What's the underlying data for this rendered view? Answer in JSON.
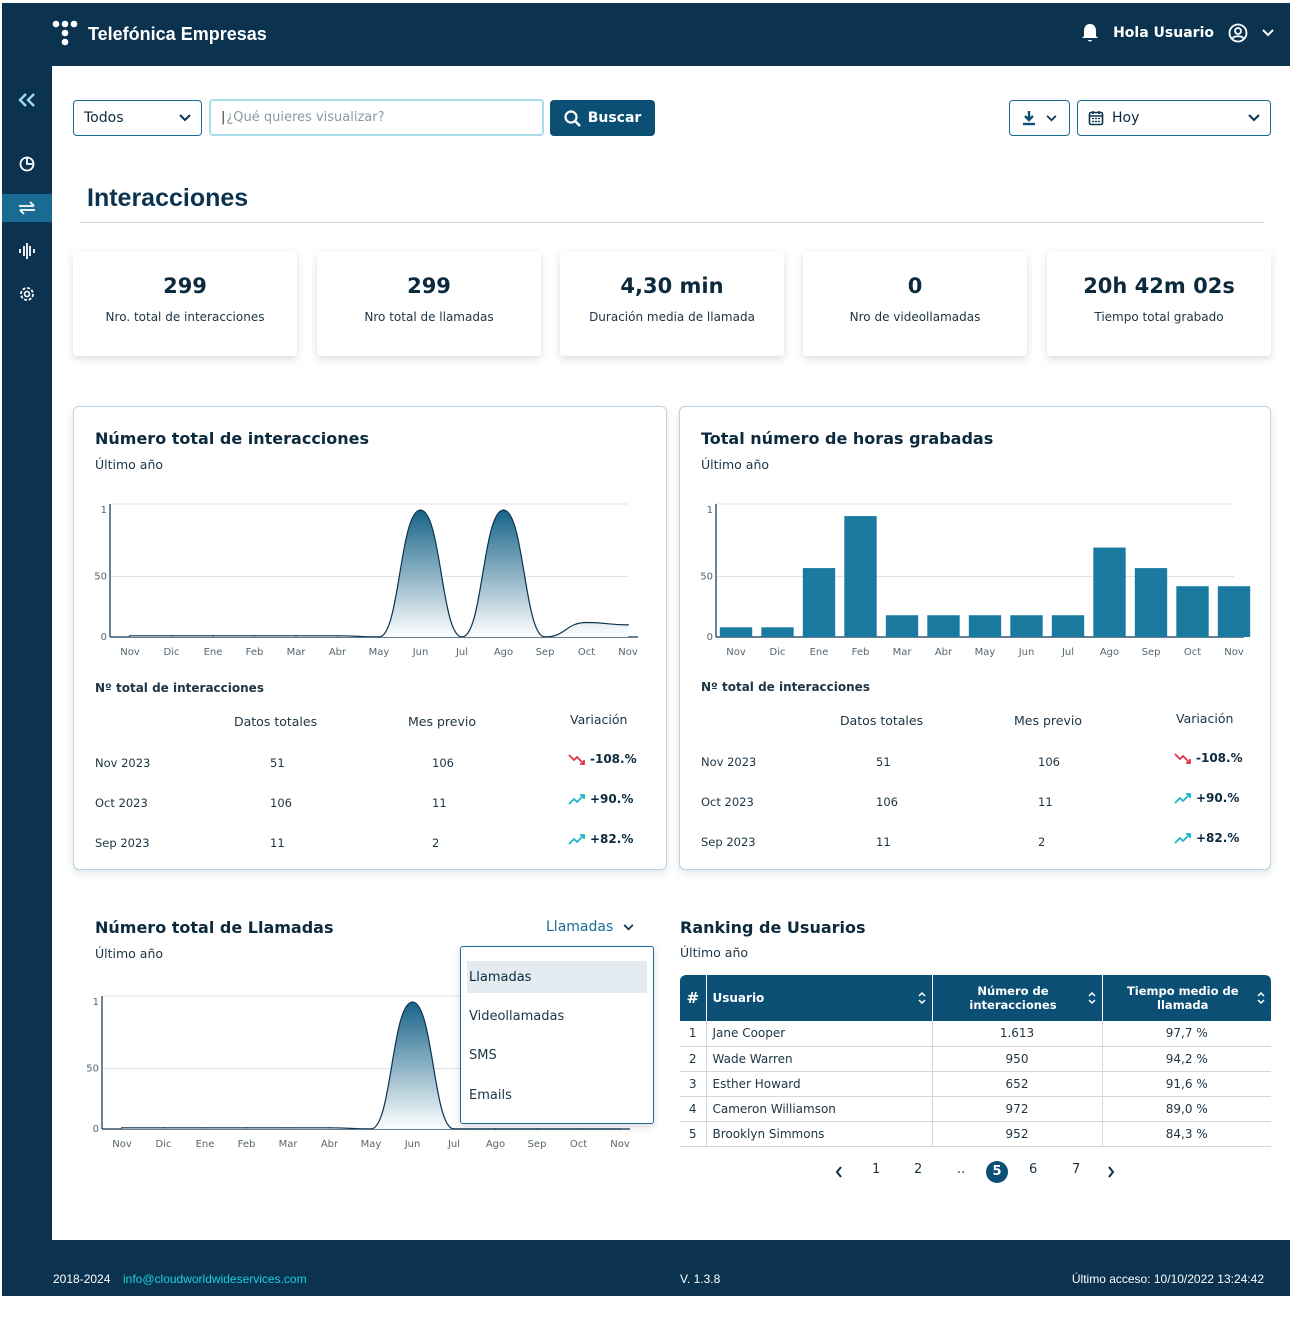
{
  "app": {
    "brand": "Telefónica Empresas",
    "greeting": "Hola Usuario"
  },
  "toolbar": {
    "filter_value": "Todos",
    "search_placeholder": "¿Qué quieres visualizar?",
    "search_button": "Buscar",
    "date_value": "Hoy"
  },
  "page": {
    "title": "Interacciones"
  },
  "kpis": [
    {
      "value": "299",
      "label": "Nro. total de interacciones"
    },
    {
      "value": "299",
      "label": "Nro total de llamadas"
    },
    {
      "value": "4,30 min",
      "label": "Duración media de llamada"
    },
    {
      "value": "0",
      "label": "Nro de videollamadas"
    },
    {
      "value": "20h 42m 02s",
      "label": "Tiempo total grabado"
    }
  ],
  "card1": {
    "title": "Número total de interacciones",
    "subtitle": "Último año",
    "table_title": "Nº total de interacciones",
    "headers": [
      "Datos totales",
      "Mes previo",
      "Variación"
    ],
    "rows": [
      {
        "period": "Nov 2023",
        "total": "51",
        "prev": "106",
        "var": "-108.%",
        "trend": "down"
      },
      {
        "period": "Oct 2023",
        "total": "106",
        "prev": "11",
        "var": "+90.%",
        "trend": "up"
      },
      {
        "period": "Sep 2023",
        "total": "11",
        "prev": "2",
        "var": "+82.%",
        "trend": "up"
      }
    ]
  },
  "card2": {
    "title": "Total número de horas grabadas",
    "subtitle": "Último año",
    "table_title": "Nº total de interacciones",
    "headers": [
      "Datos totales",
      "Mes previo",
      "Variación"
    ],
    "rows": [
      {
        "period": "Nov 2023",
        "total": "51",
        "prev": "106",
        "var": "-108.%",
        "trend": "down"
      },
      {
        "period": "Oct 2023",
        "total": "106",
        "prev": "11",
        "var": "+90.%",
        "trend": "up"
      },
      {
        "period": "Sep 2023",
        "total": "11",
        "prev": "2",
        "var": "+82.%",
        "trend": "up"
      }
    ]
  },
  "card3": {
    "title": "Número total de Llamadas",
    "subtitle": "Último año",
    "selector": "Llamadas",
    "options": [
      "Llamadas",
      "Videollamadas",
      "SMS",
      "Emails"
    ]
  },
  "ranking": {
    "title": "Ranking de Usuarios",
    "subtitle": "Último año",
    "headers": [
      "#",
      "Usuario",
      "Número de interacciones",
      "Tiempo medio de llamada"
    ],
    "rows": [
      {
        "n": "1",
        "user": "Jane Cooper",
        "inter": "1.613",
        "time": "97,7 %"
      },
      {
        "n": "2",
        "user": "Wade Warren",
        "inter": "950",
        "time": "94,2 %"
      },
      {
        "n": "3",
        "user": "Esther Howard",
        "inter": "652",
        "time": "91,6 %"
      },
      {
        "n": "4",
        "user": "Cameron Williamson",
        "inter": "972",
        "time": "89,0 %"
      },
      {
        "n": "5",
        "user": "Brooklyn Simmons",
        "inter": "952",
        "time": "84,3 %"
      }
    ],
    "pages": [
      "1",
      "2",
      "..",
      "5",
      "6",
      "7"
    ],
    "active_page": "5"
  },
  "footer": {
    "years": "2018-2024",
    "email": "info@cloudworldwideservices.com",
    "version": "V. 1.3.8",
    "last_access": "Último acceso: 10/10/2022 13:24:42"
  },
  "chart_data": [
    {
      "type": "area",
      "title": "Número total de interacciones",
      "categories": [
        "Nov",
        "Dic",
        "Ene",
        "Feb",
        "Mar",
        "Abr",
        "May",
        "Jun",
        "Jul",
        "Ago",
        "Sep",
        "Oct",
        "Nov"
      ],
      "values": [
        1,
        1,
        1,
        1,
        1,
        1,
        0,
        105,
        0,
        105,
        0,
        12,
        10
      ],
      "y_ticks": [
        "0",
        "50",
        "1"
      ],
      "colors": {
        "fill_top": "#0b5b82",
        "fill_bottom": "#ffffff",
        "line": "#0b3350"
      }
    },
    {
      "type": "bar",
      "title": "Total número de horas grabadas",
      "categories": [
        "Nov",
        "Dic",
        "Ene",
        "Feb",
        "Mar",
        "Abr",
        "May",
        "Jun",
        "Jul",
        "Ago",
        "Sep",
        "Oct",
        "Nov"
      ],
      "values": [
        8,
        8,
        57,
        100,
        18,
        18,
        18,
        18,
        18,
        74,
        57,
        42,
        42
      ],
      "y_ticks": [
        "0",
        "50",
        "1"
      ],
      "colors": {
        "bar": "#1a7aa0"
      }
    },
    {
      "type": "area",
      "title": "Número total de Llamadas",
      "categories": [
        "Nov",
        "Dic",
        "Ene",
        "Feb",
        "Mar",
        "Abr",
        "May",
        "Jun",
        "Jul",
        "Ago",
        "Sep",
        "Oct",
        "Nov"
      ],
      "values": [
        1,
        1,
        1,
        1,
        1,
        1,
        0,
        105,
        0,
        0,
        0,
        0,
        0
      ],
      "y_ticks": [
        "0",
        "50",
        "1"
      ],
      "colors": {
        "fill_top": "#0b5b82",
        "fill_bottom": "#ffffff",
        "line": "#0b3350"
      }
    }
  ]
}
